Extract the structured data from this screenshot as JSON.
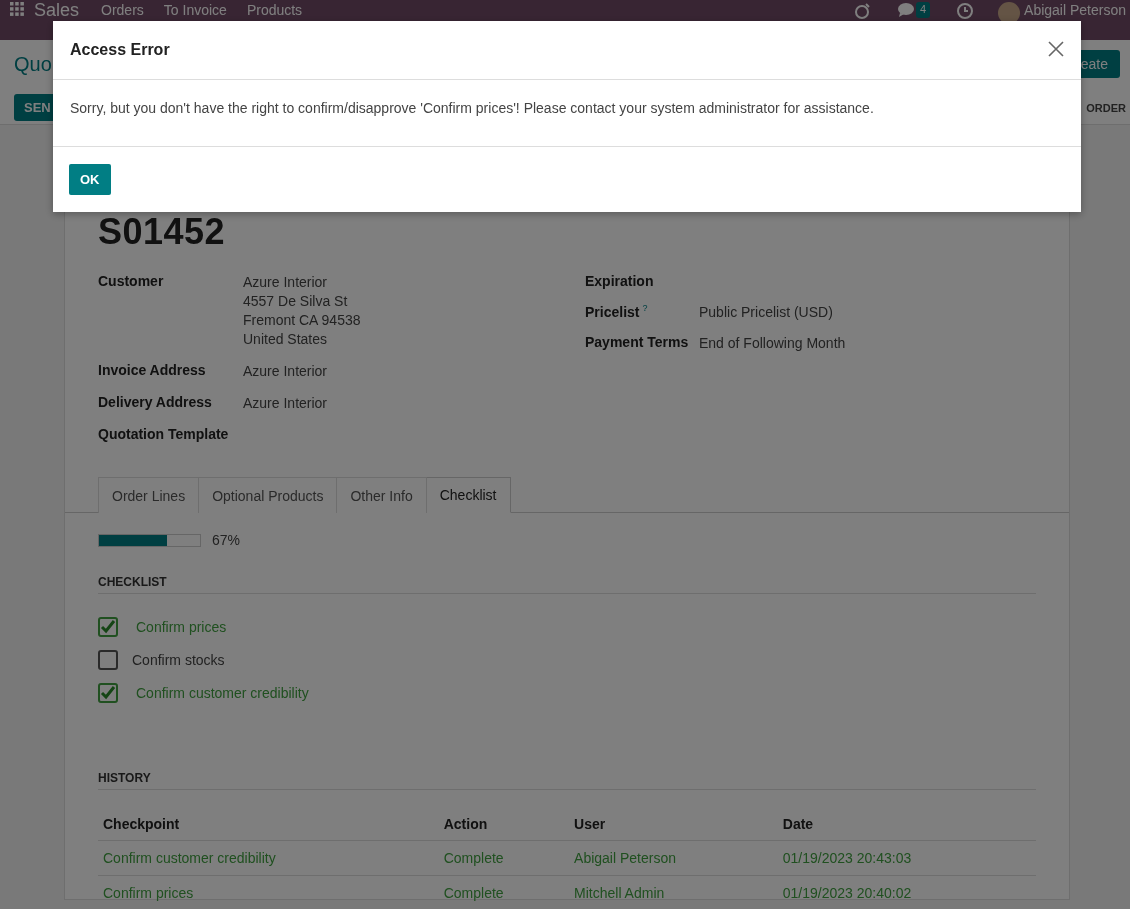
{
  "navbar": {
    "app": "Sales",
    "menu": [
      "Orders",
      "To Invoice",
      "Products"
    ],
    "chat_count": "4",
    "user": "Abigail Peterson"
  },
  "control_panel": {
    "breadcrumb": "Quo",
    "create_button": "eate",
    "send_button": "SEN",
    "order_button": "ORDER"
  },
  "record": {
    "name": "S01452",
    "left_fields": [
      {
        "label": "Customer",
        "lines": [
          "Azure Interior",
          "4557 De Silva St",
          "Fremont CA 94538",
          "United States"
        ]
      },
      {
        "label": "Invoice Address",
        "lines": [
          "Azure Interior"
        ]
      },
      {
        "label": "Delivery Address",
        "lines": [
          "Azure Interior"
        ]
      },
      {
        "label": "Quotation Template"
      }
    ],
    "right_fields": [
      {
        "label": "Expiration"
      },
      {
        "label": "Pricelist",
        "help": "?",
        "lines": [
          "Public Pricelist (USD)"
        ]
      },
      {
        "label": "Payment Terms",
        "lines": [
          "End of Following Month"
        ]
      }
    ]
  },
  "tabs": [
    {
      "label": "Order Lines",
      "selected": false
    },
    {
      "label": "Optional Products",
      "selected": false
    },
    {
      "label": "Other Info",
      "selected": false
    },
    {
      "label": "Checklist",
      "selected": true
    }
  ],
  "progress": {
    "level": 0.67,
    "reading": "67%"
  },
  "checklist": {
    "title": "CHECKLIST",
    "items": [
      {
        "label": "Confirm prices",
        "checked": true
      },
      {
        "label": "Confirm stocks",
        "checked": false
      },
      {
        "label": "Confirm customer credibility",
        "checked": true
      }
    ]
  },
  "history": {
    "title": "HISTORY",
    "columns": [
      "Checkpoint",
      "Action",
      "User",
      "Date"
    ],
    "rows": [
      [
        "Confirm customer credibility",
        "Complete",
        "Abigail Peterson",
        "01/19/2023 20:43:03"
      ],
      [
        "Confirm prices",
        "Complete",
        "Mitchell Admin",
        "01/19/2023 20:40:02"
      ]
    ]
  },
  "dialog": {
    "title": "Access Error",
    "message": "Sorry, but you don't have the right to confirm/disapprove 'Confirm prices'! Please contact your system administrator for assistance.",
    "button": "OK"
  }
}
